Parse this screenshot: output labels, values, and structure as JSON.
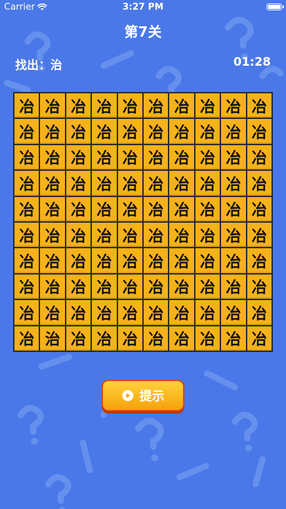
{
  "status_bar": {
    "carrier": "Carrier",
    "time": "3:27 PM",
    "wifi_icon": "wifi-icon",
    "battery_icon": "battery-icon"
  },
  "header": {
    "level_title": "第7关",
    "find_label": "找出：治",
    "timer": "01:28"
  },
  "grid": {
    "rows": 10,
    "cols": 10,
    "tiles": [
      [
        "冶",
        "冶",
        "冶",
        "冶",
        "冶",
        "冶",
        "冶",
        "冶",
        "冶",
        "冶"
      ],
      [
        "冶",
        "冶",
        "冶",
        "冶",
        "冶",
        "冶",
        "冶",
        "冶",
        "冶",
        "冶"
      ],
      [
        "冶",
        "冶",
        "冶",
        "冶",
        "冶",
        "冶",
        "冶",
        "冶",
        "冶",
        "冶"
      ],
      [
        "冶",
        "冶",
        "冶",
        "冶",
        "冶",
        "冶",
        "冶",
        "冶",
        "冶",
        "冶"
      ],
      [
        "冶",
        "冶",
        "冶",
        "冶",
        "冶",
        "冶",
        "冶",
        "冶",
        "冶",
        "冶"
      ],
      [
        "冶",
        "冶",
        "冶",
        "冶",
        "冶",
        "冶",
        "冶",
        "冶",
        "冶",
        "冶"
      ],
      [
        "冶",
        "冶",
        "冶",
        "冶",
        "冶",
        "冶",
        "冶",
        "冶",
        "冶",
        "冶"
      ],
      [
        "冶",
        "冶",
        "冶",
        "冶",
        "冶",
        "冶",
        "冶",
        "冶",
        "冶",
        "冶"
      ],
      [
        "冶",
        "冶",
        "冶",
        "冶",
        "冶",
        "冶",
        "冶",
        "冶",
        "冶",
        "冶"
      ],
      [
        "冶",
        "治",
        "冶",
        "冶",
        "冶",
        "冶",
        "冶",
        "冶",
        "冶",
        "冶"
      ]
    ]
  },
  "hint_button": {
    "label": "提示",
    "icon": "play-circle-icon"
  },
  "colors": {
    "background": "#4a78e8",
    "tile": "#f6b21a",
    "button": "#f5a10c"
  }
}
